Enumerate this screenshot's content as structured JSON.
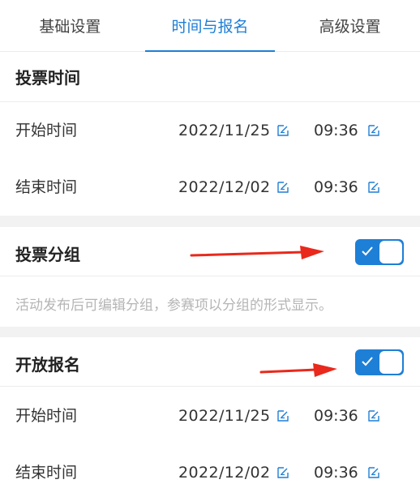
{
  "tabs": [
    {
      "label": "基础设置"
    },
    {
      "label": "时间与报名"
    },
    {
      "label": "高级设置"
    }
  ],
  "vote_time": {
    "title": "投票时间",
    "start": {
      "label": "开始时间",
      "date": "2022/11/25",
      "time": "09:36"
    },
    "end": {
      "label": "结束时间",
      "date": "2022/12/02",
      "time": "09:36"
    }
  },
  "vote_group": {
    "title": "投票分组",
    "enabled": true,
    "hint": "活动发布后可编辑分组，参赛项以分组的形式显示。"
  },
  "registration": {
    "title": "开放报名",
    "enabled": true,
    "start": {
      "label": "开始时间",
      "date": "2022/11/25",
      "time": "09:36"
    },
    "end": {
      "label": "结束时间",
      "date": "2022/12/02",
      "time": "09:36"
    }
  },
  "colors": {
    "accent": "#1e7fd6",
    "arrow": "#e8291c"
  },
  "icons": {
    "edit": "edit-icon",
    "check": "check-icon",
    "arrow": "annotation-arrow"
  }
}
